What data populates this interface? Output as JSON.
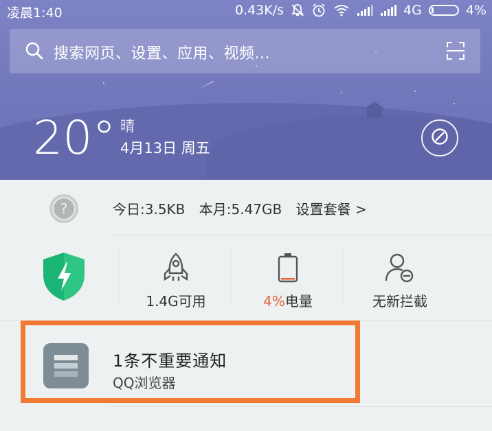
{
  "status_bar": {
    "time": "凌晨1:40",
    "speed": "0.43K/s",
    "network": "4G",
    "battery": "4%"
  },
  "search": {
    "placeholder": "搜索网页、设置、应用、视频..."
  },
  "weather": {
    "temperature": "20°",
    "condition": "晴",
    "date": "4月13日 周五"
  },
  "data_usage": {
    "today": "今日:3.5KB",
    "month": "本月:5.47GB",
    "plan_link": "设置套餐 >"
  },
  "tools": [
    {
      "label": "1.4G可用",
      "icon": "rocket-icon"
    },
    {
      "label_pct": "4%",
      "label_text": "电量",
      "icon": "battery-icon",
      "pct_color": "#e5633a"
    },
    {
      "label": "无新拦截",
      "icon": "user-block-icon"
    }
  ],
  "notification": {
    "title": "1条不重要通知",
    "subtitle": "QQ浏览器",
    "highlight_color": "#f07a33"
  }
}
